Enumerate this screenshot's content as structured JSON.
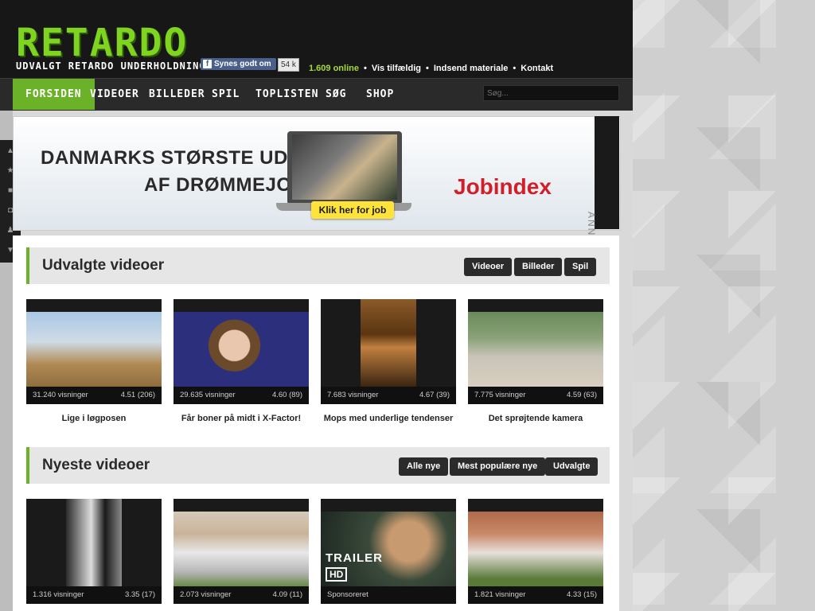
{
  "header": {
    "logo": "RETARDO",
    "tagline": "UDVALGT RETARDO UNDERHOLDNING",
    "fb_like": "Synes godt om",
    "fb_count": "54 k",
    "online": "1.609 online",
    "links": [
      "Vis tilfældig",
      "Indsend materiale",
      "Kontakt"
    ]
  },
  "nav": {
    "items": [
      "FORSIDEN",
      "VIDEOER",
      "BILLEDER",
      "SPIL",
      "TOPLISTEN",
      "SØG",
      "SHOP"
    ],
    "search_placeholder": "Søg..."
  },
  "banner": {
    "line1": "DANMARKS STØRSTE UDVALG",
    "line2": "AF DRØMMEJOB",
    "cta": "Klik her for job",
    "brand": "Jobindex",
    "ad_label": "ANNONCE"
  },
  "featured": {
    "title": "Udvalgte videoer",
    "buttons": [
      "Videoer",
      "Billeder",
      "Spil"
    ],
    "videos": [
      {
        "views": "31.240 visninger",
        "rating": "4.51 (206)",
        "title": "Lige i løgposen"
      },
      {
        "views": "29.635 visninger",
        "rating": "4.60 (89)",
        "title": "Får boner på midt i X-Factor!"
      },
      {
        "views": "7.683 visninger",
        "rating": "4.67 (39)",
        "title": "Mops med underlige tendenser"
      },
      {
        "views": "7.775 visninger",
        "rating": "4.59 (63)",
        "title": "Det sprøjtende kamera"
      }
    ]
  },
  "newest": {
    "title": "Nyeste videoer",
    "buttons": [
      "Alle nye",
      "Mest populære nye",
      "Udvalgte"
    ],
    "videos": [
      {
        "views": "1.316 visninger",
        "rating": "3.35 (17)"
      },
      {
        "views": "2.073 visninger",
        "rating": "4.09 (11)"
      },
      {
        "views": "Sponsoreret",
        "rating": "",
        "overlay1": "TRAILER",
        "overlay2": "HD"
      },
      {
        "views": "1.821 visninger",
        "rating": "4.33 (15)"
      }
    ]
  }
}
